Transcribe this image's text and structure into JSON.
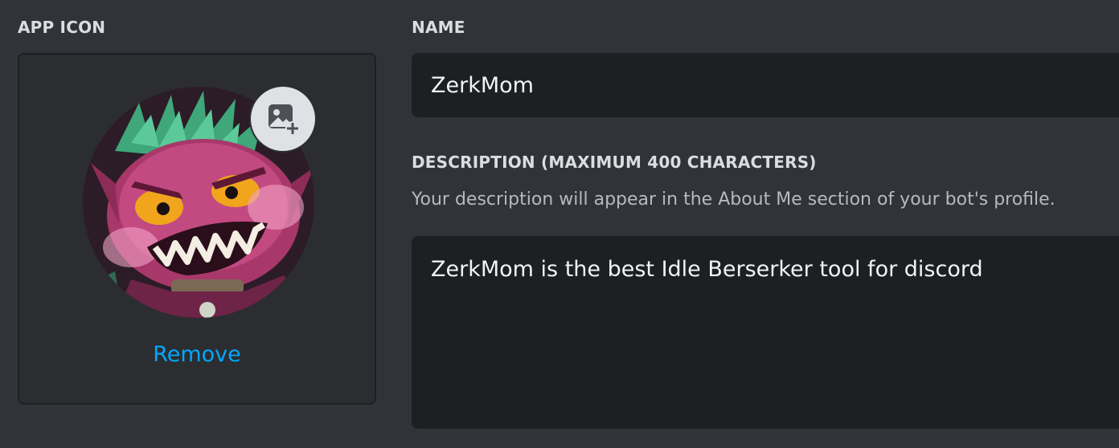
{
  "app_icon": {
    "label": "APP ICON",
    "remove_label": "Remove",
    "upload_icon": "image-plus-icon"
  },
  "name": {
    "label": "NAME",
    "value": "ZerkMom"
  },
  "description": {
    "label": "DESCRIPTION (MAXIMUM 400 CHARACTERS)",
    "helper": "Your description will appear in the About Me section of your bot's profile.",
    "value": "ZerkMom is the best Idle Berserker tool for discord"
  },
  "colors": {
    "background": "#313338",
    "input_background": "#1e1f22",
    "link": "#00a8fc"
  }
}
